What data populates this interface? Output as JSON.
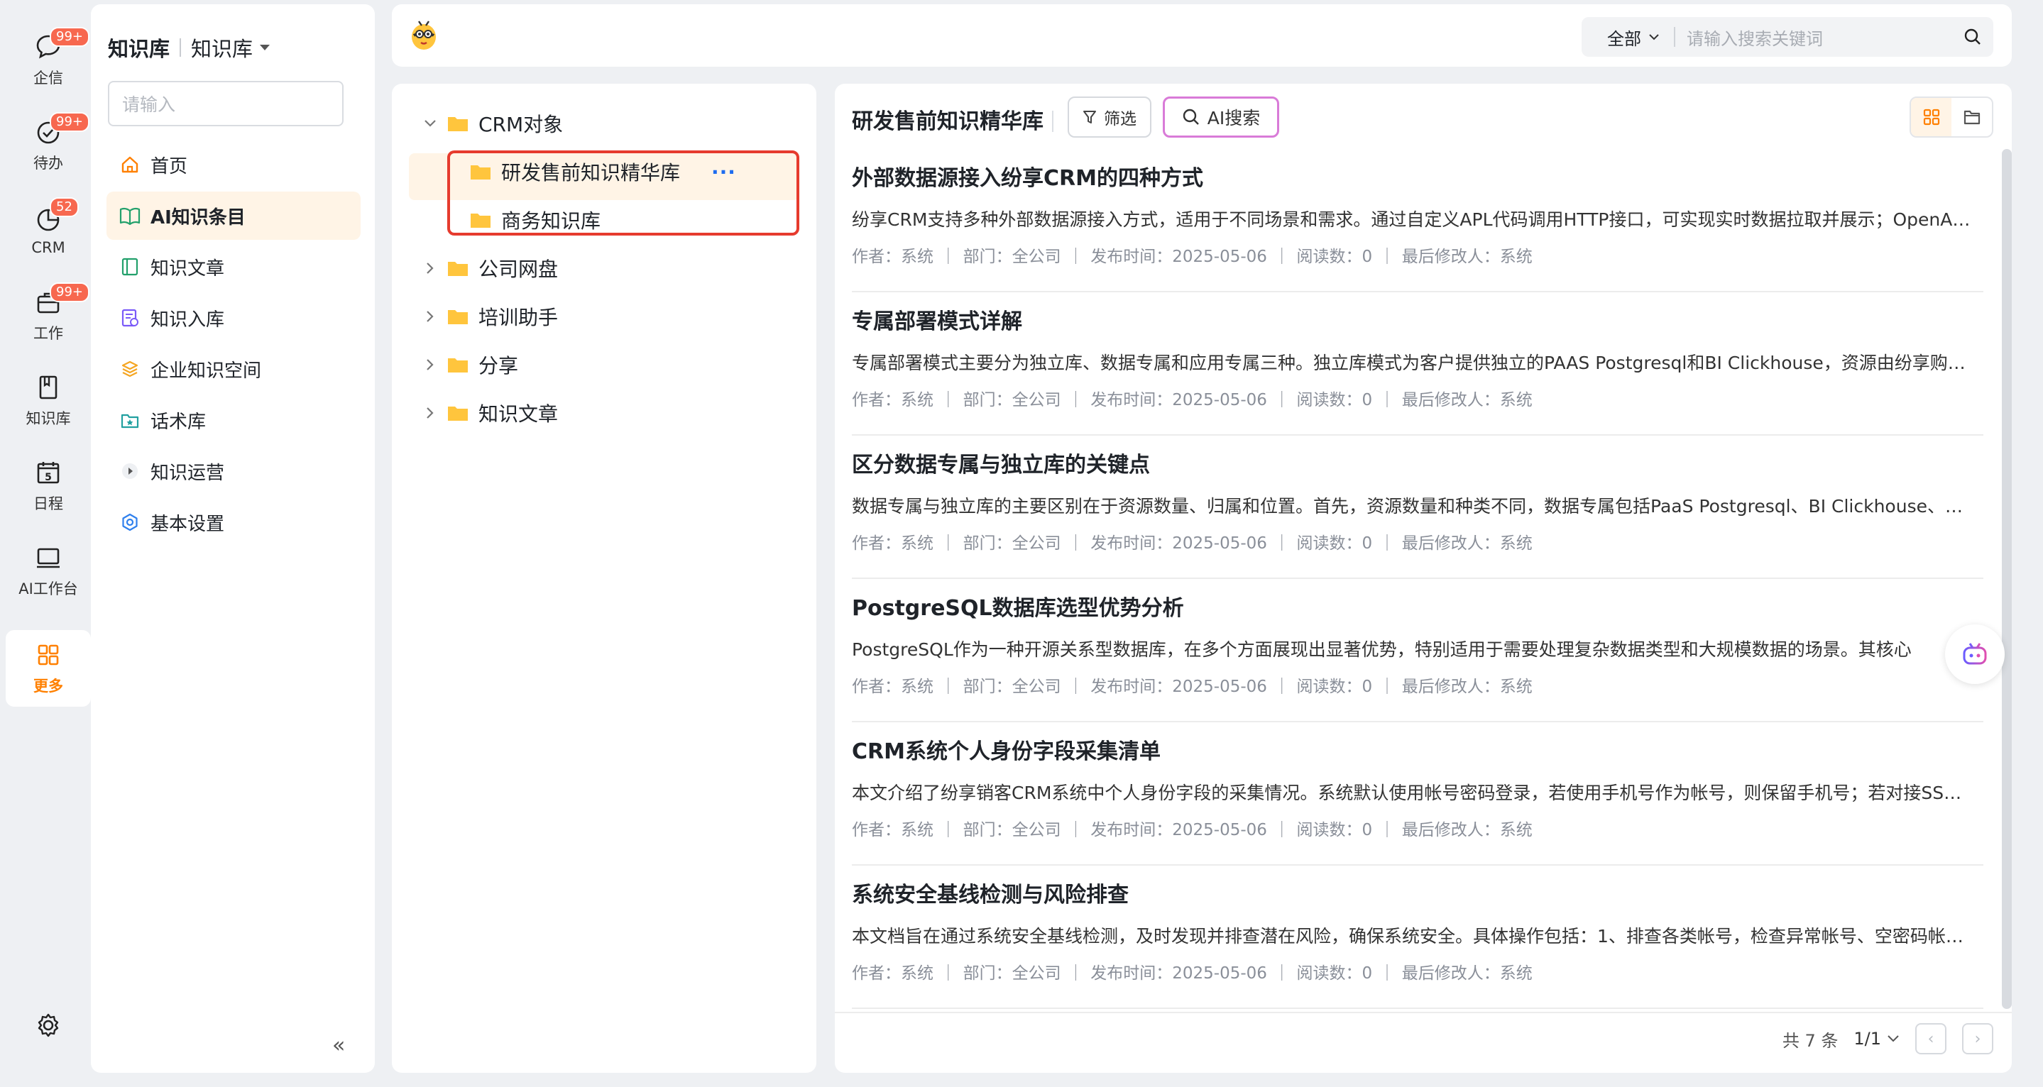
{
  "rail": {
    "items": [
      {
        "label": "企信",
        "badge": "99+"
      },
      {
        "label": "待办",
        "badge": "99+"
      },
      {
        "label": "CRM",
        "badge": "52"
      },
      {
        "label": "工作",
        "badge": "99+"
      },
      {
        "label": "知识库",
        "badge": ""
      },
      {
        "label": "日程",
        "badge": ""
      },
      {
        "label": "AI工作台",
        "badge": ""
      },
      {
        "label": "更多",
        "badge": ""
      }
    ],
    "calendar_day": "5",
    "accent": "#ff8000"
  },
  "sidebar": {
    "title": "知识库",
    "subtitle": "知识库",
    "search_placeholder": "请输入",
    "items": [
      {
        "label": "首页"
      },
      {
        "label": "AI知识条目"
      },
      {
        "label": "知识文章"
      },
      {
        "label": "知识入库"
      },
      {
        "label": "企业知识空间"
      },
      {
        "label": "话术库"
      },
      {
        "label": "知识运营"
      },
      {
        "label": "基本设置"
      }
    ],
    "collapse": "«"
  },
  "topbar": {
    "scope": "全部",
    "search_placeholder": "请输入搜索关键词"
  },
  "tree": {
    "root": "CRM对象",
    "children": [
      "研发售前知识精华库",
      "商务知识库"
    ],
    "selected_more": "···",
    "others": [
      "公司网盘",
      "培训助手",
      "分享",
      "知识文章"
    ]
  },
  "main": {
    "title": "研发售前知识精华库",
    "filter_label": "筛选",
    "ai_search_label": "AI搜索",
    "articles": [
      {
        "title": "外部数据源接入纷享CRM的四种方式",
        "summary": "纷享CRM支持多种外部数据源接入方式，适用于不同场景和需求。通过自定义APL代码调用HTTP接口，可实现实时数据拉取并展示；OpenAPI接口适合系统间数据批量同步",
        "meta": "作者：系统  ｜  部门：全公司  ｜  发布时间：2025-05-06  ｜  阅读数：0  ｜  最后修改人：系统"
      },
      {
        "title": "专属部署模式详解",
        "summary": "专属部署模式主要分为独立库、数据专属和应用专属三种。独立库模式为客户提供独立的PAAS Postgresql和BI Clickhouse，资源由纷享购买并管理，适用于数据隔离需求",
        "meta": "作者：系统  ｜  部门：全公司  ｜  发布时间：2025-05-06  ｜  阅读数：0  ｜  最后修改人：系统"
      },
      {
        "title": "区分数据专属与独立库的关键点",
        "summary": "数据专属与独立库的主要区别在于资源数量、归属和位置。首先，资源数量和种类不同，数据专属包括PaaS Postgresql、BI Clickhouse、ES等多种资源",
        "meta": "作者：系统  ｜  部门：全公司  ｜  发布时间：2025-05-06  ｜  阅读数：0  ｜  最后修改人：系统"
      },
      {
        "title": "PostgreSQL数据库选型优势分析",
        "summary": "PostgreSQL作为一种开源关系型数据库，在多个方面展现出显著优势，特别适用于需要处理复杂数据类型和大规模数据的场景。其核心",
        "meta": "作者：系统  ｜  部门：全公司  ｜  发布时间：2025-05-06  ｜  阅读数：0  ｜  最后修改人：系统"
      },
      {
        "title": "CRM系统个人身份字段采集清单",
        "summary": "本文介绍了纷享销客CRM系统中个人身份字段的采集情况。系统默认使用帐号密码登录，若使用手机号作为帐号，则保留手机号；若对接SSO单点登录则采集对应标识",
        "meta": "作者：系统  ｜  部门：全公司  ｜  发布时间：2025-05-06  ｜  阅读数：0  ｜  最后修改人：系统"
      },
      {
        "title": "系统安全基线检测与风险排查",
        "summary": "本文档旨在通过系统安全基线检测，及时发现并排查潜在风险，确保系统安全。具体操作包括：1、排查各类帐号，检查异常帐号、空密码帐号及弱口令帐号",
        "meta": "作者：系统  ｜  部门：全公司  ｜  发布时间：2025-05-06  ｜  阅读数：0  ｜  最后修改人：系统"
      }
    ],
    "total": "共 7 条",
    "page": "1/1",
    "prev": "‹",
    "next": "›"
  }
}
